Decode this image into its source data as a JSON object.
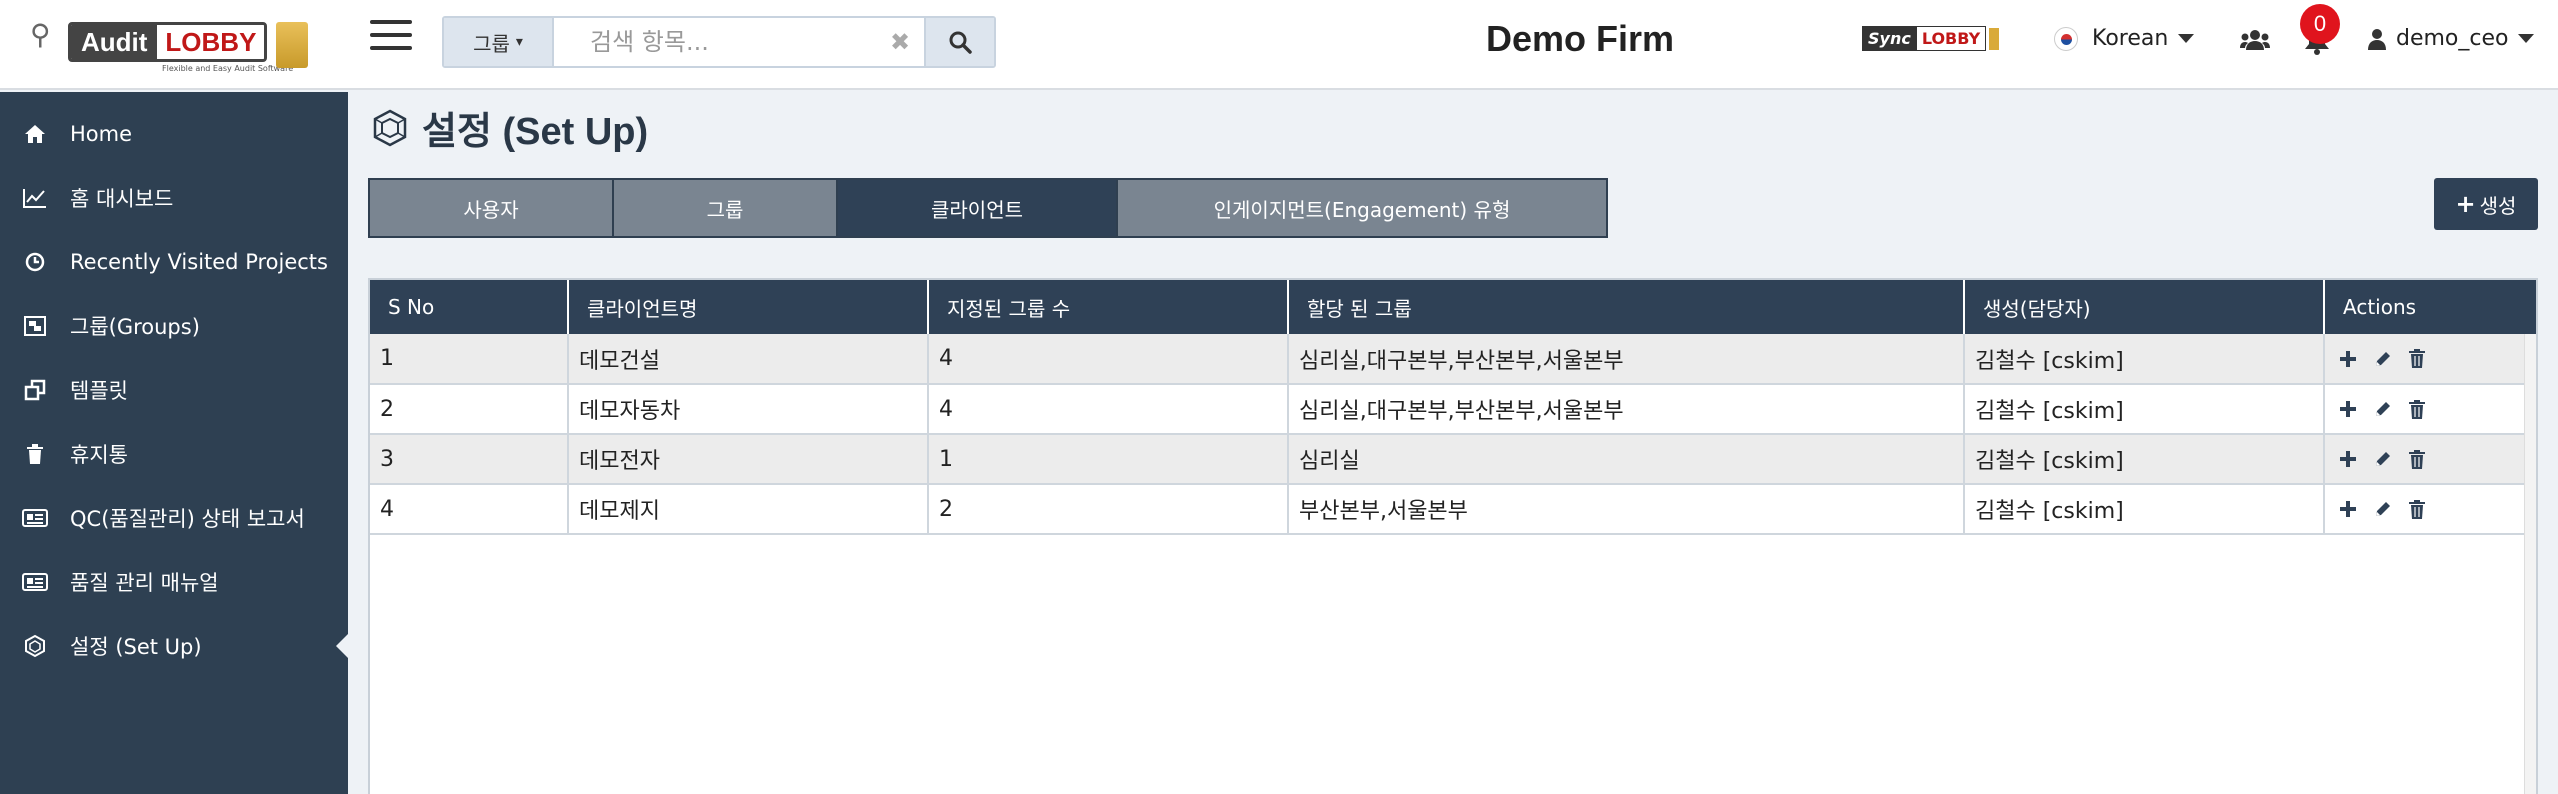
{
  "header": {
    "logo": {
      "word1": "Audit",
      "word2": "LOBBY",
      "tagline": "Flexible and Easy Audit Software"
    },
    "search": {
      "dropdown_label": "그룹",
      "placeholder": "검색 항목..."
    },
    "firm_name": "Demo Firm",
    "sync_logo": {
      "word1": "Sync",
      "word2": "LOBBY"
    },
    "language": "Korean",
    "notification_count": "0",
    "username": "demo_ceo"
  },
  "sidebar": {
    "items": [
      {
        "label": "Home",
        "icon": "home-icon"
      },
      {
        "label": "홈 대시보드",
        "icon": "line-chart-icon"
      },
      {
        "label": "Recently Visited Projects",
        "icon": "clock-icon"
      },
      {
        "label": "그룹(Groups)",
        "icon": "group-object-icon"
      },
      {
        "label": "템플릿",
        "icon": "clone-icon"
      },
      {
        "label": "휴지통",
        "icon": "trash-icon"
      },
      {
        "label": "QC(품질관리) 상태 보고서",
        "icon": "newspaper-icon"
      },
      {
        "label": "품질 관리 매뉴얼",
        "icon": "newspaper-icon"
      },
      {
        "label": "설정 (Set Up)",
        "icon": "setup-icon"
      }
    ],
    "active_index": 8
  },
  "main": {
    "title": "설정 (Set Up)",
    "tabs": [
      {
        "label": "사용자"
      },
      {
        "label": "그룹"
      },
      {
        "label": "클라이언트"
      },
      {
        "label": "인게이지먼트(Engagement) 유형"
      }
    ],
    "active_tab": 2,
    "create_button": "생성",
    "table": {
      "headers": [
        "S No",
        "클라이언트명",
        "지정된 그룹 수",
        "할당 된 그룹",
        "생성(담당자)",
        "Actions"
      ],
      "rows": [
        [
          "1",
          "데모건설",
          "4",
          "심리실,대구본부,부산본부,서울본부",
          "김철수 [cskim]"
        ],
        [
          "2",
          "데모자동차",
          "4",
          "심리실,대구본부,부산본부,서울본부",
          "김철수 [cskim]"
        ],
        [
          "3",
          "데모전자",
          "1",
          "심리실",
          "김철수 [cskim]"
        ],
        [
          "4",
          "데모제지",
          "2",
          "부산본부,서울본부",
          "김철수 [cskim]"
        ]
      ]
    }
  },
  "colors": {
    "sidebar_bg": "#2e4052",
    "accent_dark": "#2f4156",
    "tab_inactive": "#7a8591",
    "badge": "#e0141d"
  }
}
